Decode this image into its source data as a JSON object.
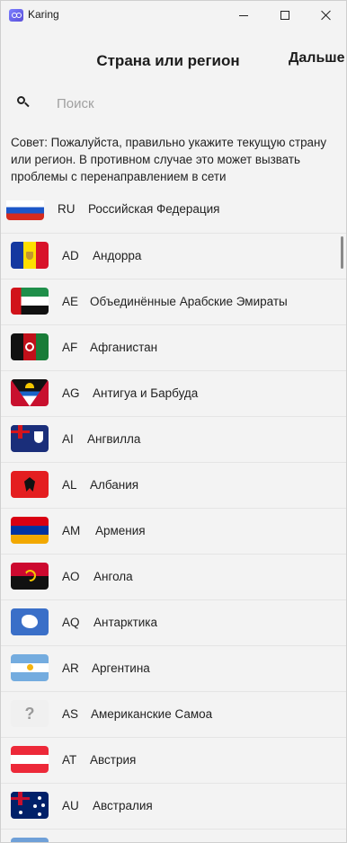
{
  "window": {
    "title": "Karing"
  },
  "header": {
    "title": "Страна или регион",
    "next_label": "Дальше"
  },
  "search": {
    "placeholder": "Поиск",
    "value": ""
  },
  "tip": "Совет: Пожалуйста, правильно укажите текущую страну или регион. В противном случае это может вызвать проблемы с перенаправлением в сети",
  "countries": [
    {
      "code": "RU",
      "name": "Российская Федерация",
      "flag": "ru-flag"
    },
    {
      "code": "AD",
      "name": "Андорра",
      "flag": "ad-flag"
    },
    {
      "code": "AE",
      "name": "Объединённые Арабские Эмираты",
      "flag": "ae-flag"
    },
    {
      "code": "AF",
      "name": "Афганистан",
      "flag": "af-flag"
    },
    {
      "code": "AG",
      "name": "Антигуа и Барбуда",
      "flag": "ag-flag"
    },
    {
      "code": "AI",
      "name": "Ангвилла",
      "flag": "ai-flag"
    },
    {
      "code": "AL",
      "name": "Албания",
      "flag": "al-flag"
    },
    {
      "code": "AM",
      "name": "Армения",
      "flag": "am-flag"
    },
    {
      "code": "AO",
      "name": "Ангола",
      "flag": "ao-flag"
    },
    {
      "code": "AQ",
      "name": "Антарктика",
      "flag": "aq-flag"
    },
    {
      "code": "AR",
      "name": "Аргентина",
      "flag": "ar-flag"
    },
    {
      "code": "AS",
      "name": "Американские Самоа",
      "flag": "unknown-flag"
    },
    {
      "code": "AT",
      "name": "Австрия",
      "flag": "at-flag"
    },
    {
      "code": "AU",
      "name": "Австралия",
      "flag": "au-flag"
    }
  ]
}
